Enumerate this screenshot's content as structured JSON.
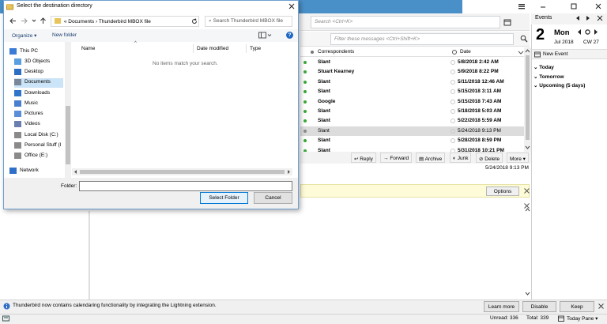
{
  "dialog": {
    "title": "Select the destination directory",
    "address_crumbs": [
      "«",
      "Documents",
      "›",
      "Thunderbird MBOX file"
    ],
    "search_placeholder": "Search Thunderbird MBOX file",
    "organize_label": "Organize ▾",
    "new_folder_label": "New folder",
    "tree_items": [
      "This PC",
      "3D Objects",
      "Desktop",
      "Documents",
      "Downloads",
      "Music",
      "Pictures",
      "Videos",
      "Local Disk (C:)",
      "Personal Stuff (I",
      "Office (E:)",
      "Network"
    ],
    "columns": [
      "Name",
      "Date modified",
      "Type"
    ],
    "empty_message": "No items match your search.",
    "folder_label": "Folder:",
    "folder_value": "",
    "select_button": "Select Folder",
    "cancel_button": "Cancel",
    "help_glyph": "?"
  },
  "thunderbird": {
    "search_placeholder": "Search <Ctrl+K>",
    "filter_placeholder": "Filter these messages <Ctrl+Shift+K>",
    "col_correspondents": "Correspondents",
    "col_date": "Date",
    "messages": [
      {
        "from": "Slant",
        "date": "5/8/2018 2:42 AM"
      },
      {
        "from": "Stuart Kearney",
        "date": "5/9/2018 8:22 PM"
      },
      {
        "from": "Slant",
        "date": "5/11/2018 12:46 AM"
      },
      {
        "from": "Slant",
        "date": "5/15/2018 3:11 AM"
      },
      {
        "from": "Google",
        "date": "5/15/2018 7:43 AM"
      },
      {
        "from": "Slant",
        "date": "5/18/2018 5:03 AM"
      },
      {
        "from": "Slant",
        "date": "5/22/2018 5:59 AM"
      },
      {
        "from": "Slant",
        "date": "5/24/2018 9:13 PM"
      },
      {
        "from": "Slant",
        "date": "5/28/2018 8:59 PM"
      },
      {
        "from": "Slant",
        "date": "5/31/2018 10:21 PM"
      }
    ],
    "actions": {
      "reply": "Reply",
      "forward": "Forward",
      "archive": "Archive",
      "junk": "Junk",
      "delete": "Delete",
      "more": "More ▾"
    },
    "preview_date": "5/24/2018 9:13 PM",
    "options_label": "Options",
    "notification": "Thunderbird now contains calendaring functionality by integrating the Lightning extension.",
    "learn_more": "Learn more",
    "disable": "Disable",
    "keep": "Keep",
    "unread": "Unread: 336",
    "total": "Total: 339",
    "today_pane": "Today Pane ▾"
  },
  "events": {
    "title": "Events",
    "day_number": "2",
    "weekday": "Mon",
    "month_year": "Jul 2018",
    "week": "CW 27",
    "new_event": "New Event",
    "sections": [
      "Today",
      "Tomorrow",
      "Upcoming (5 days)"
    ]
  },
  "colors": {
    "accent": "#0078d7",
    "titlebar": "#4a90c8",
    "unread_dot": "#3aa83a"
  }
}
